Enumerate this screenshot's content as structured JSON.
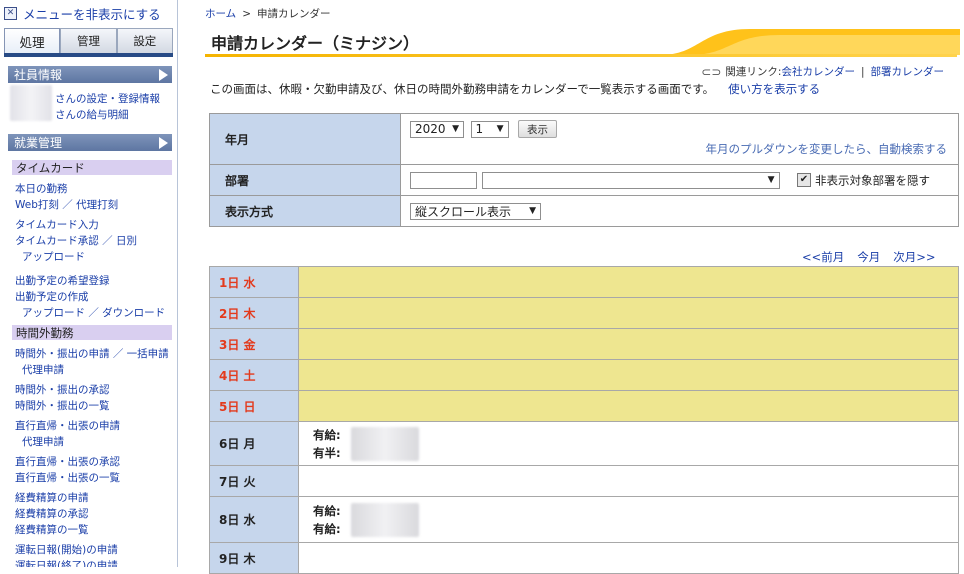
{
  "sidebar": {
    "hide_menu": "メニューを非表示にする",
    "tabs": [
      {
        "label": "処理",
        "active": true
      },
      {
        "label": "管理",
        "active": false
      },
      {
        "label": "設定",
        "active": false
      }
    ],
    "employee_info": {
      "title": "社員情報",
      "links": [
        "さんの設定・登録情報",
        "さんの給与明細"
      ]
    },
    "work_mgmt": {
      "title": "就業管理"
    },
    "timecard": {
      "title": "タイムカード",
      "links": [
        "本日の勤務",
        "Web打刻 ／ 代理打刻",
        "タイムカード入力",
        "タイムカード承認 ／ 日別",
        "アップロード",
        "出勤予定の希望登録",
        "出勤予定の作成",
        "アップロード ／ ダウンロード"
      ]
    },
    "overtime": {
      "title": "時間外勤務",
      "links": [
        "時間外・振出の申請 ／ 一括申請",
        "代理申請",
        "時間外・振出の承認",
        "時間外・振出の一覧",
        "直行直帰・出張の申請",
        "代理申請",
        "直行直帰・出張の承認",
        "直行直帰・出張の一覧",
        "経費精算の申請",
        "経費精算の承認",
        "経費精算の一覧",
        "運転日報(開始)の申請",
        "運転日報(終了)の申請"
      ]
    }
  },
  "breadcrumb": {
    "home": "ホーム",
    "separator": ">",
    "current": "申請カレンダー"
  },
  "title": "申請カレンダー（ミナジン）",
  "related": {
    "prefix": "関連リンク:",
    "company_calendar": "会社カレンダー",
    "separator": "|",
    "dept_calendar": "部署カレンダー"
  },
  "intro": {
    "text": "この画面は、休暇・欠勤申請及び、休日の時間外勤務申請をカレンダーで一覧表示する画面です。",
    "howto": "使い方を表示する"
  },
  "form": {
    "year_month": {
      "label": "年月",
      "year": "2020",
      "month": "1",
      "show_button": "表示",
      "hint": "年月のプルダウンを変更したら、自動検索する"
    },
    "department": {
      "label": "部署",
      "code": "",
      "name": "",
      "hide_checkbox_checked": true,
      "hide_checkbox_label": "非表示対象部署を隠す"
    },
    "display_mode": {
      "label": "表示方式",
      "value": "縦スクロール表示"
    }
  },
  "month_nav": {
    "prev": "<<前月",
    "current": "今月",
    "next": "次月>>"
  },
  "calendar": {
    "colors": {
      "holiday_bg": "#eee690",
      "holiday_text": "#e33a1d",
      "day_cell_bg": "#c6d6ec"
    },
    "days": [
      {
        "label": "1日 水",
        "holiday": true,
        "entries": []
      },
      {
        "label": "2日 木",
        "holiday": true,
        "entries": []
      },
      {
        "label": "3日 金",
        "holiday": true,
        "entries": []
      },
      {
        "label": "4日 土",
        "holiday": true,
        "entries": []
      },
      {
        "label": "5日 日",
        "holiday": true,
        "entries": []
      },
      {
        "label": "6日 月",
        "holiday": false,
        "entries": [
          "有給:",
          "有半:"
        ]
      },
      {
        "label": "7日 火",
        "holiday": false,
        "entries": []
      },
      {
        "label": "8日 水",
        "holiday": false,
        "entries": [
          "有給:",
          "有給:"
        ]
      },
      {
        "label": "9日 木",
        "holiday": false,
        "entries": []
      }
    ]
  }
}
